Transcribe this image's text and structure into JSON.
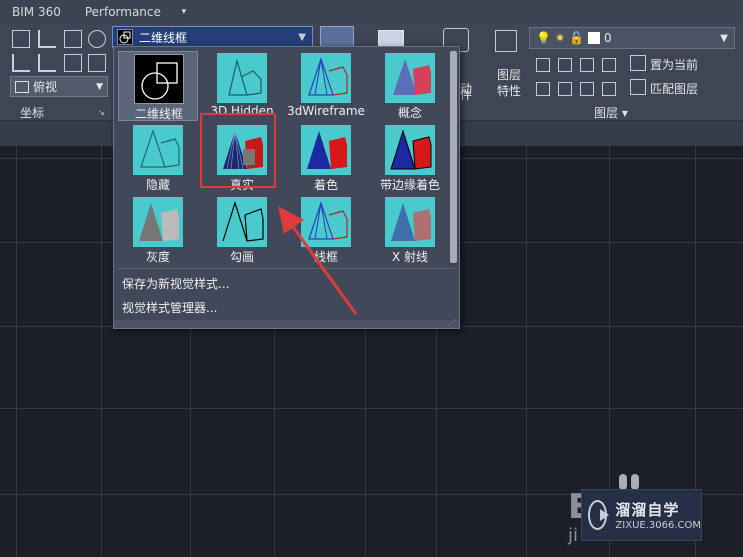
{
  "tabs": [
    "BIM 360",
    "Performance"
  ],
  "tab_more_icon": "chevron-down",
  "ribbon": {
    "visual_style_current": "二维线框",
    "view_current": "俯视",
    "coordinates_label": "坐标",
    "layer": {
      "current": "0",
      "layer_properties": [
        "图层",
        "特性"
      ],
      "set_current": "置为当前",
      "match_layer": "匹配图层",
      "group_label": "图层"
    },
    "partial_text": [
      "动",
      "件"
    ]
  },
  "styles": [
    {
      "label": "二维线框",
      "icon": "2d-wireframe-icon",
      "active": true
    },
    {
      "label": "3D Hidden",
      "icon": "3d-hidden-icon"
    },
    {
      "label": "3dWireframe",
      "icon": "3d-wireframe-icon"
    },
    {
      "label": "概念",
      "icon": "conceptual-icon"
    },
    {
      "label": "隐藏",
      "icon": "hidden-icon"
    },
    {
      "label": "真实",
      "icon": "realistic-icon",
      "highlighted": true
    },
    {
      "label": "着色",
      "icon": "shaded-icon"
    },
    {
      "label": "带边缘着色",
      "icon": "shaded-edges-icon"
    },
    {
      "label": "灰度",
      "icon": "shades-of-gray-icon"
    },
    {
      "label": "勾画",
      "icon": "sketchy-icon"
    },
    {
      "label": "线框",
      "icon": "wireframe-icon"
    },
    {
      "label": "X 射线",
      "icon": "x-ray-icon"
    }
  ],
  "menu": {
    "save_new": "保存为新视觉样式...",
    "manager": "视觉样式管理器..."
  },
  "watermark": {
    "title": "溜溜自学",
    "url": "ZIXUE.3066.COM"
  },
  "canvas_text": {
    "big": "E",
    "small": "ji"
  },
  "colors": {
    "accent_red": "#e03a3a",
    "tile_bg": "#49cacc",
    "panel": "#40485a"
  }
}
